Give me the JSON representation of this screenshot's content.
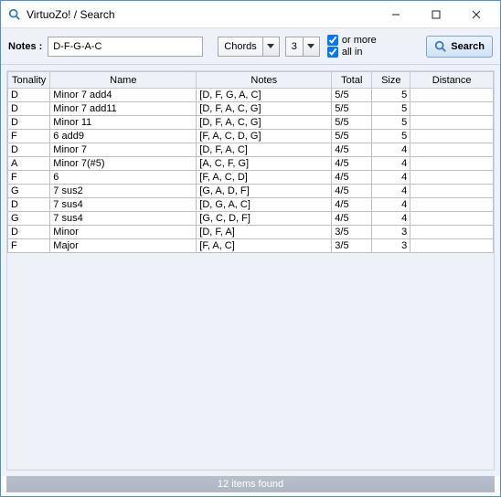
{
  "window": {
    "title": "VirtuoZo! / Search"
  },
  "toolbar": {
    "notes_label": "Notes :",
    "notes_value": "D-F-G-A-C",
    "type_combo": "Chords",
    "count_combo": "3",
    "check_or_more": "or more",
    "check_all_in": "all in",
    "search_label": "Search"
  },
  "table": {
    "headers": {
      "tonality": "Tonality",
      "name": "Name",
      "notes": "Notes",
      "total": "Total",
      "size": "Size",
      "distance": "Distance"
    },
    "rows": [
      {
        "tonality": "D",
        "name": "Minor 7 add4",
        "notes": "[D, F, G, A, C]",
        "total": "5/5",
        "size": "5",
        "distance": ""
      },
      {
        "tonality": "D",
        "name": "Minor 7 add11",
        "notes": "[D, F, A, C, G]",
        "total": "5/5",
        "size": "5",
        "distance": ""
      },
      {
        "tonality": "D",
        "name": "Minor 11",
        "notes": "[D, F, A, C, G]",
        "total": "5/5",
        "size": "5",
        "distance": ""
      },
      {
        "tonality": "F",
        "name": "6 add9",
        "notes": "[F, A, C, D, G]",
        "total": "5/5",
        "size": "5",
        "distance": ""
      },
      {
        "tonality": "D",
        "name": "Minor 7",
        "notes": "[D, F, A, C]",
        "total": "4/5",
        "size": "4",
        "distance": ""
      },
      {
        "tonality": "A",
        "name": "Minor 7(#5)",
        "notes": "[A, C, F, G]",
        "total": "4/5",
        "size": "4",
        "distance": ""
      },
      {
        "tonality": "F",
        "name": "6",
        "notes": "[F, A, C, D]",
        "total": "4/5",
        "size": "4",
        "distance": ""
      },
      {
        "tonality": "G",
        "name": "7 sus2",
        "notes": "[G, A, D, F]",
        "total": "4/5",
        "size": "4",
        "distance": ""
      },
      {
        "tonality": "D",
        "name": "7 sus4",
        "notes": "[D, G, A, C]",
        "total": "4/5",
        "size": "4",
        "distance": ""
      },
      {
        "tonality": "G",
        "name": "7 sus4",
        "notes": "[G, C, D, F]",
        "total": "4/5",
        "size": "4",
        "distance": ""
      },
      {
        "tonality": "D",
        "name": "Minor",
        "notes": "[D, F, A]",
        "total": "3/5",
        "size": "3",
        "distance": ""
      },
      {
        "tonality": "F",
        "name": "Major",
        "notes": "[F, A, C]",
        "total": "3/5",
        "size": "3",
        "distance": ""
      }
    ]
  },
  "status": {
    "text": "12 items found"
  }
}
